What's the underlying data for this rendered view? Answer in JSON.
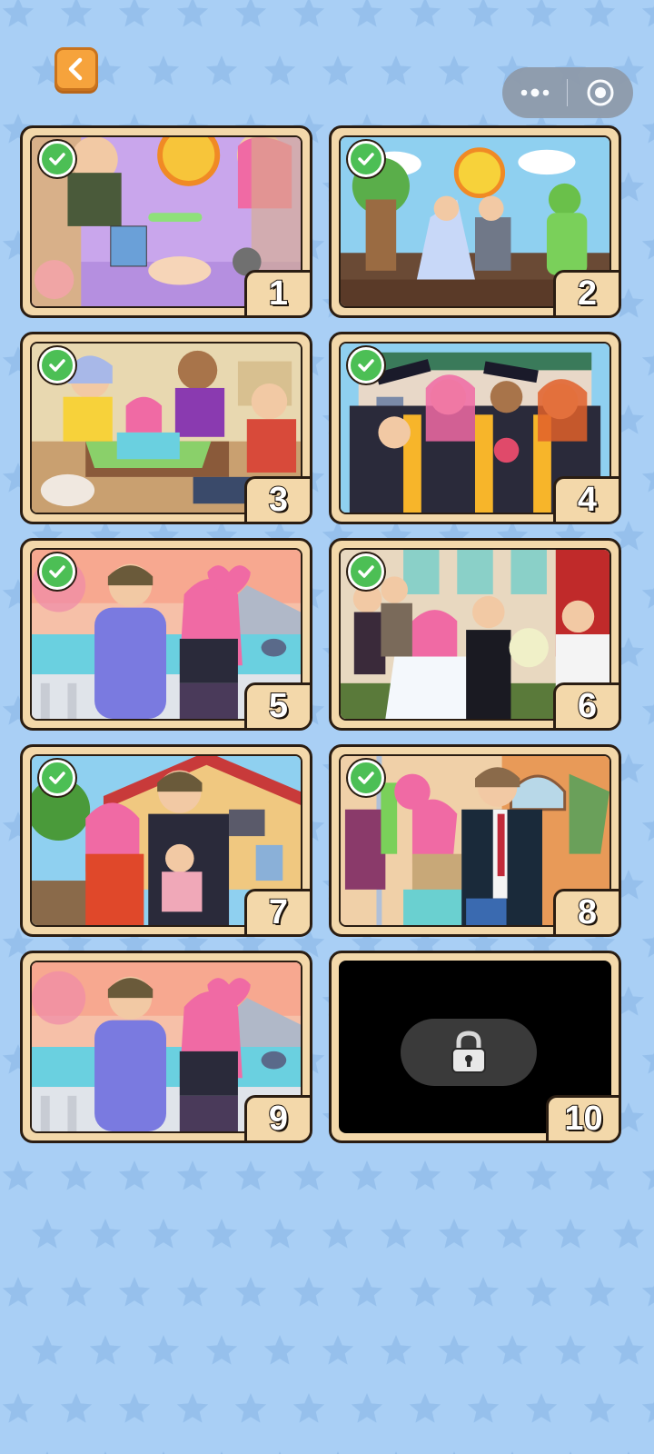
{
  "header": {
    "back_icon": "chevron-left-icon",
    "capsule_more_icon": "more-dots-icon",
    "capsule_close_icon": "record-circle-icon"
  },
  "colors": {
    "background": "#a9cff5",
    "star": "#96c0ec",
    "card_frame": "#f3d8aa",
    "check": "#4cbf55",
    "back_button": "#f6a33c"
  },
  "levels": [
    {
      "number": "1",
      "completed": true,
      "scene": "nursery"
    },
    {
      "number": "2",
      "completed": true,
      "scene": "school-play"
    },
    {
      "number": "3",
      "completed": true,
      "scene": "board-game"
    },
    {
      "number": "4",
      "completed": true,
      "scene": "graduation"
    },
    {
      "number": "5",
      "completed": true,
      "scene": "lakeside-date"
    },
    {
      "number": "6",
      "completed": true,
      "scene": "wedding"
    },
    {
      "number": "7",
      "completed": true,
      "scene": "family-home"
    },
    {
      "number": "8",
      "completed": true,
      "scene": "tie-fixing"
    },
    {
      "number": "9",
      "completed": true,
      "scene": "lakeside-date"
    },
    {
      "number": "10",
      "completed": false,
      "scene": "locked",
      "lock_icon": "padlock-icon"
    }
  ]
}
